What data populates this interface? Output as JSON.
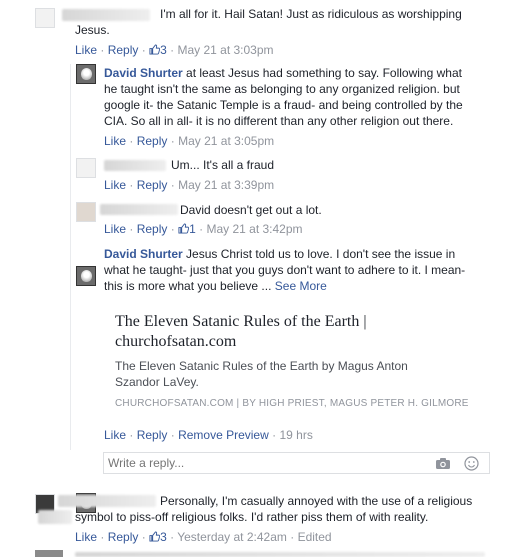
{
  "comments": [
    {
      "text": "I'm all for it. Hail Satan! Just as ridiculous as worshipping Jesus.",
      "like_label": "Like",
      "reply_label": "Reply",
      "likes": "3",
      "time": "May 21 at 3:03pm"
    },
    {
      "author": "David Shurter",
      "text": "at least Jesus had something to say. Following what he taught isn't the same as belonging to any organized religion. but google it- the Satanic Temple is a fraud- and being controlled by the CIA. So all in all- it is no different than any other religion out there.",
      "like_label": "Like",
      "reply_label": "Reply",
      "time": "May 21 at 3:05pm"
    },
    {
      "text": "Um... It's all a fraud",
      "like_label": "Like",
      "reply_label": "Reply",
      "time": "May 21 at 3:39pm"
    },
    {
      "text": "David doesn't get out a lot.",
      "like_label": "Like",
      "reply_label": "Reply",
      "likes": "1",
      "time": "May 21 at 3:42pm"
    },
    {
      "author": "David Shurter",
      "text": "Jesus Christ told us to love. I don't see the issue in what he taught- just that you guys don't want to adhere to it. I mean- this is more what you believe ...",
      "see_more": "See More",
      "like_label": "Like",
      "reply_label": "Reply",
      "remove_preview": "Remove Preview",
      "time": "19 hrs"
    },
    {
      "text": "Personally, I'm casually annoyed with the use of a religious symbol to piss-off religious folks. I'd rather piss them of with reality.",
      "like_label": "Like",
      "reply_label": "Reply",
      "likes": "3",
      "time": "Yesterday at 2:42am",
      "edited": "Edited"
    }
  ],
  "link_preview": {
    "title": "The Eleven Satanic Rules of the Earth | churchofsatan.com",
    "description": "The Eleven Satanic Rules of the Earth by Magus Anton Szandor LaVey.",
    "source": "CHURCHOFSATAN.COM | BY HIGH PRIEST, MAGUS PETER H. GILMORE"
  },
  "reply_box": {
    "placeholder": "Write a reply...",
    "camera_icon": "camera-icon",
    "emoji_icon": "emoji-icon"
  },
  "separators": {
    "dot": "·"
  },
  "colors": {
    "link": "#365899",
    "meta": "#90949c",
    "text": "#1d2129"
  }
}
